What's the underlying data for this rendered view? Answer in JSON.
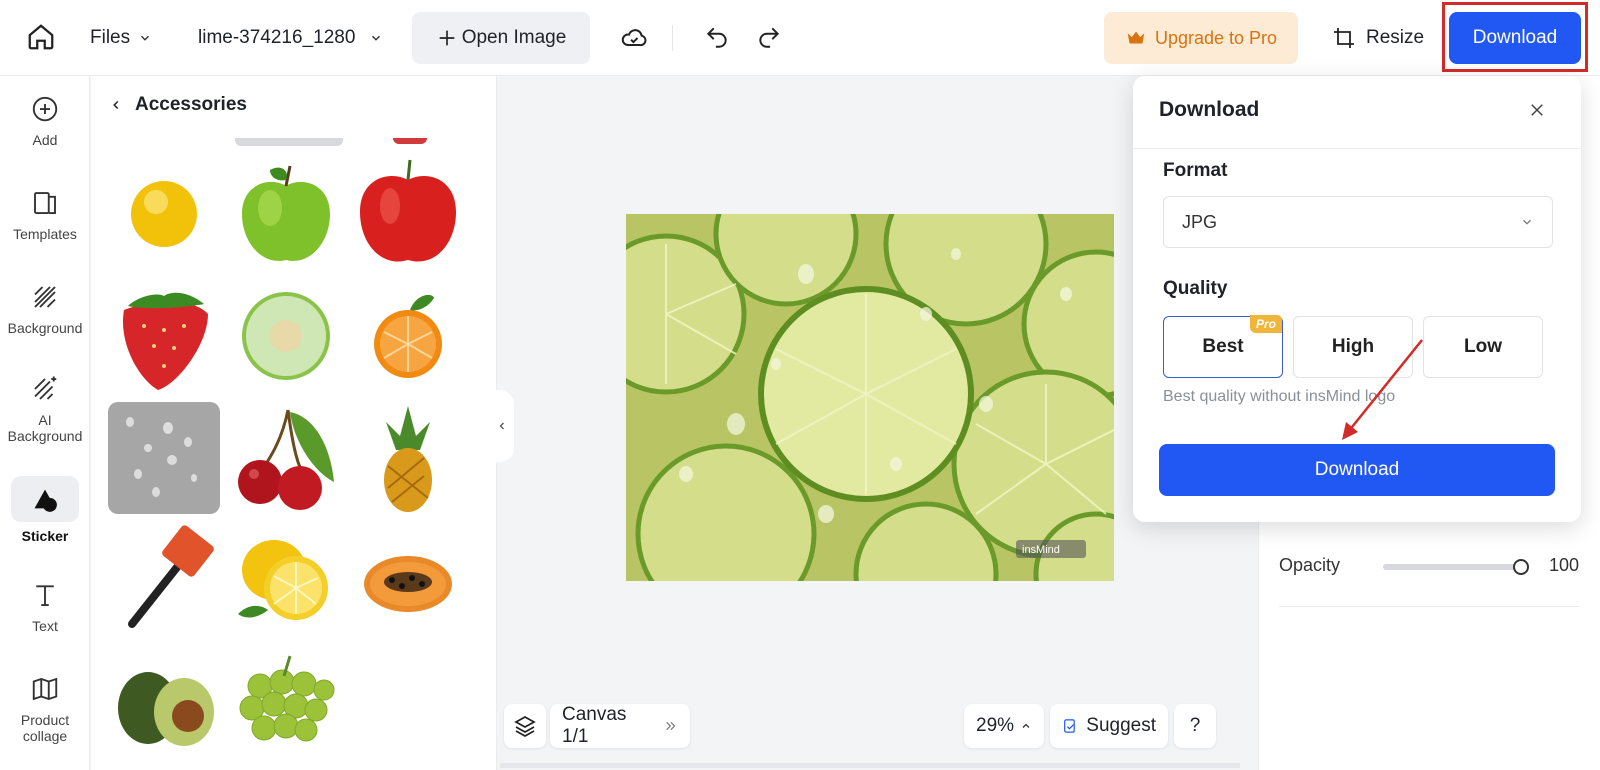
{
  "topbar": {
    "files_label": "Files",
    "filename": "lime-374216_1280",
    "open_image": "Open Image",
    "upgrade": "Upgrade to Pro",
    "resize": "Resize",
    "download": "Download"
  },
  "rail": {
    "items": [
      {
        "label": "Add",
        "icon": "plus-circle-icon"
      },
      {
        "label": "Templates",
        "icon": "templates-icon"
      },
      {
        "label": "Background",
        "icon": "background-icon"
      },
      {
        "label": "AI Background",
        "icon": "ai-background-icon"
      },
      {
        "label": "Sticker",
        "icon": "sticker-icon"
      },
      {
        "label": "Text",
        "icon": "text-icon"
      },
      {
        "label": "Product collage",
        "icon": "collage-icon"
      }
    ],
    "active": "Sticker"
  },
  "panel": {
    "title": "Accessories",
    "stickers": [
      "lemon-drop",
      "green-apple",
      "red-apple",
      "strawberry",
      "honeydew-melon",
      "orange-half",
      "water-drops",
      "cherries",
      "pineapple",
      "hammer",
      "lemon-slices",
      "papaya",
      "avocado",
      "grapes"
    ]
  },
  "canvas": {
    "page_label": "Canvas 1/1",
    "zoom": "29%",
    "suggest": "Suggest",
    "help": "?",
    "watermark": "insMind"
  },
  "props": {
    "opacity_label": "Opacity",
    "opacity_value": "100"
  },
  "download_popover": {
    "title": "Download",
    "format_label": "Format",
    "format_value": "JPG",
    "quality_label": "Quality",
    "quality_options": [
      "Best",
      "High",
      "Low"
    ],
    "selected_quality": "Best",
    "pro_badge": "Pro",
    "hint": "Best quality without insMind logo",
    "download_button": "Download"
  },
  "colors": {
    "primary": "#2157f2",
    "upgrade_bg": "#fdebd6",
    "upgrade_text": "#d9730d",
    "highlight_frame": "#d32a2a",
    "pro_badge": "#f0b63a"
  }
}
